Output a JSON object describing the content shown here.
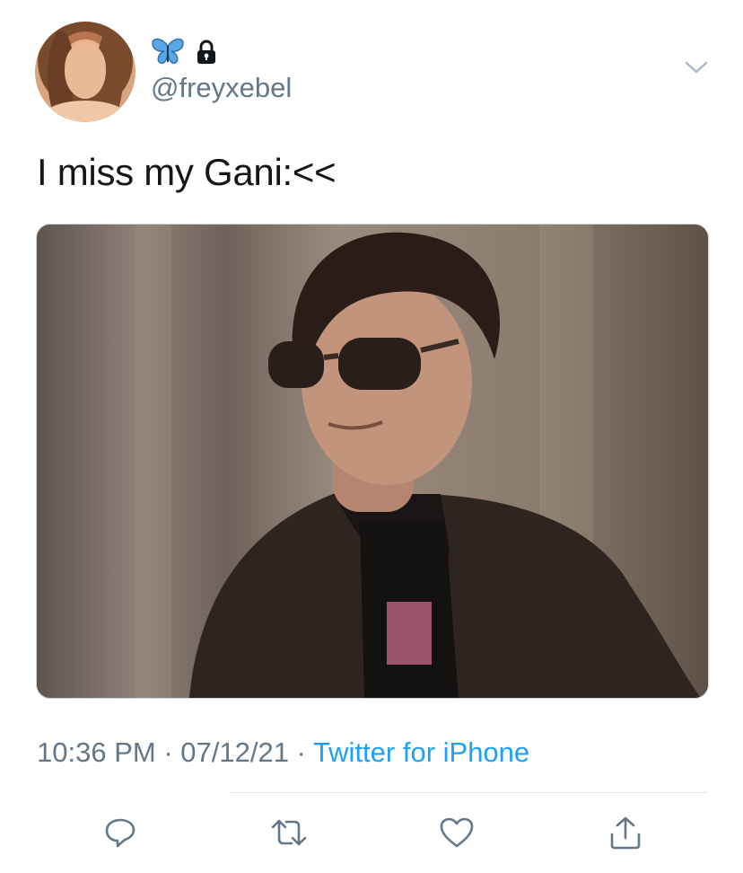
{
  "tweet": {
    "handle": "@freyxebel",
    "name_emoji": "butterfly-icon",
    "locked": true,
    "text": "I miss my Gani:<<",
    "time": "10:36 PM",
    "date": "07/12/21",
    "source": "Twitter for iPhone",
    "separator": " · "
  },
  "actions": [
    {
      "name": "reply",
      "icon": "reply-icon"
    },
    {
      "name": "retweet",
      "icon": "retweet-icon"
    },
    {
      "name": "like",
      "icon": "heart-icon"
    },
    {
      "name": "share",
      "icon": "share-icon"
    }
  ],
  "colors": {
    "text": "#14171a",
    "secondary": "#657786",
    "link": "#1da1f2",
    "butterfly": "#5aa9e6"
  }
}
